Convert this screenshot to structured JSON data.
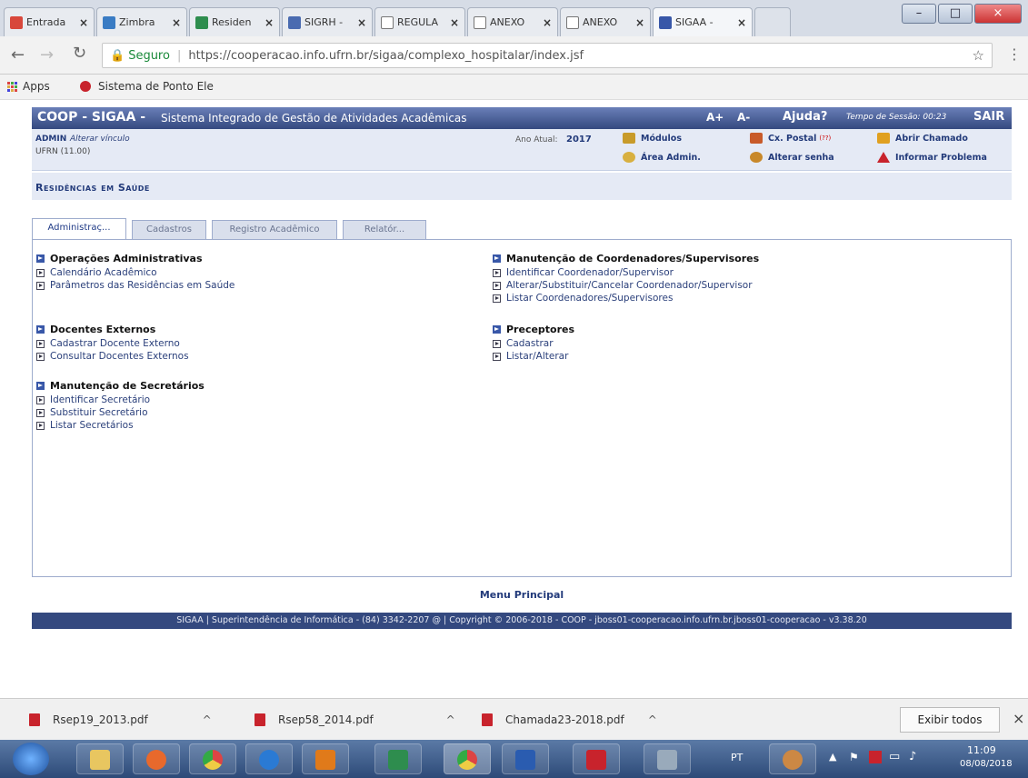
{
  "browser": {
    "tabs": [
      {
        "label": "Entrada",
        "icon": "gmail-icon"
      },
      {
        "label": "Zimbra",
        "icon": "zimbra-icon"
      },
      {
        "label": "Residen",
        "icon": "residencia-icon"
      },
      {
        "label": "SIGRH -",
        "icon": "sigrh-icon"
      },
      {
        "label": "REGULA",
        "icon": "document-icon"
      },
      {
        "label": "ANEXO",
        "icon": "document-icon"
      },
      {
        "label": "ANEXO",
        "icon": "document-icon"
      },
      {
        "label": "SIGAA -",
        "icon": "sigaa-icon"
      }
    ],
    "secure_label": "Seguro",
    "url": "https://cooperacao.info.ufrn.br/sigaa/complexo_hospitalar/index.jsf",
    "bookmarks": [
      {
        "label": "Apps",
        "icon": "apps-icon"
      },
      {
        "label": "Sistema de Ponto Ele",
        "icon": "bookmark-icon"
      }
    ]
  },
  "system": {
    "title": "COOP - SIGAA -",
    "subtitle": "Sistema Integrado de Gestão de Atividades Acadêmicas",
    "font_up": "A+",
    "font_down": "A-",
    "help": "Ajuda?",
    "session_label": "Tempo de Sessão: 00:23",
    "logout": "SAIR"
  },
  "info": {
    "user": "ADMIN",
    "change_link": "Alterar vínculo",
    "unit": "UFRN (11.00)",
    "year_label": "Ano Atual:",
    "year": "2017",
    "modules": "Módulos",
    "postal": "Cx. Postal",
    "postal_count": "(??)",
    "ticket": "Abrir Chamado",
    "admin_area": "Área Admin.",
    "change_password": "Alterar senha",
    "report_problem": "Informar Problema"
  },
  "module_title": "Residências em Saúde",
  "tabs": [
    "Administraç...",
    "Cadastros",
    "Registro Acadêmico",
    "Relatór..."
  ],
  "sections": {
    "left": [
      {
        "title": "Operações Administrativas",
        "items": [
          "Calendário Acadêmico",
          "Parâmetros das Residências em Saúde"
        ]
      },
      {
        "title": "Docentes Externos",
        "items": [
          "Cadastrar Docente Externo",
          "Consultar Docentes Externos"
        ]
      },
      {
        "title": "Manutenção de Secretários",
        "items": [
          "Identificar Secretário",
          "Substituir Secretário",
          "Listar Secretários"
        ]
      }
    ],
    "right": [
      {
        "title": "Manutenção de Coordenadores/Supervisores",
        "items": [
          "Identificar Coordenador/Supervisor",
          "Alterar/Substituir/Cancelar Coordenador/Supervisor",
          "Listar Coordenadores/Supervisores"
        ]
      },
      {
        "title": "Preceptores",
        "items": [
          "Cadastrar",
          "Listar/Alterar"
        ]
      }
    ]
  },
  "menu_principal": "Menu Principal",
  "footer": "SIGAA | Superintendência de Informática - (84) 3342-2207 @ | Copyright © 2006-2018 - COOP - jboss01-cooperacao.info.ufrn.br.jboss01-cooperacao - v3.38.20",
  "downloads": [
    {
      "name": "Rsep19_2013.pdf"
    },
    {
      "name": "Rsep58_2014.pdf"
    },
    {
      "name": "Chamada23-2018.pdf"
    }
  ],
  "show_all": "Exibir todos",
  "taskbar": {
    "lang": "PT",
    "time": "11:09",
    "date": "08/08/2018"
  },
  "colors": {
    "primary": "#34497f",
    "link": "#2a3f7a",
    "pdf": "#c8232c"
  }
}
